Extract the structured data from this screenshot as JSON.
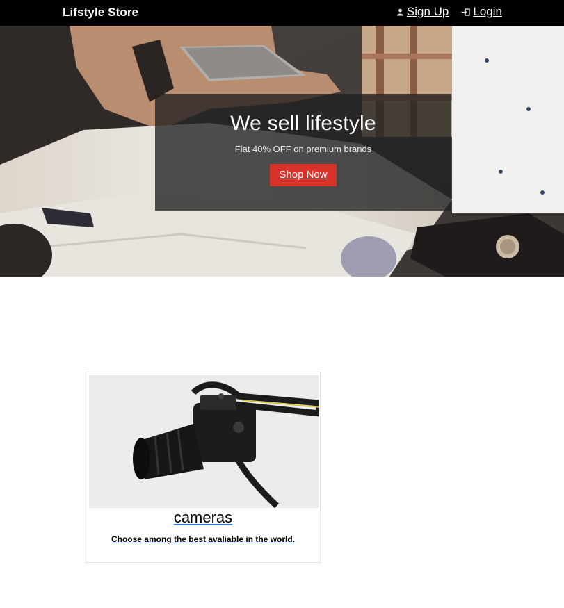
{
  "navbar": {
    "brand": "Lifstyle Store",
    "signup": {
      "label": "Sign Up",
      "icon": "user-icon"
    },
    "login": {
      "label": "Login",
      "icon": "login-icon"
    }
  },
  "hero": {
    "title": "We sell lifestyle",
    "subtitle": "Flat 40% OFF on premium brands",
    "button": "Shop Now"
  },
  "product_card": {
    "title": "cameras",
    "description": "Choose among the best avaliable in the world."
  },
  "colors": {
    "navbar_bg": "#000000",
    "button_red": "#d9322b",
    "link_underline": "#3a7bd5"
  }
}
